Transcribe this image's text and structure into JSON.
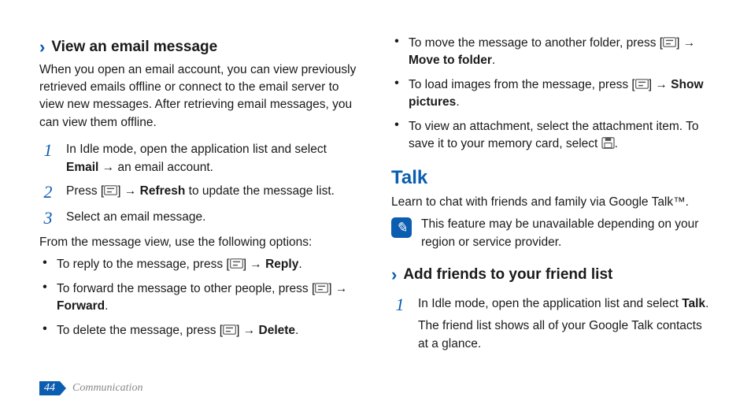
{
  "left": {
    "heading1": "View an email message",
    "intro": "When you open an email account, you can view previously retrieved emails offline or connect to the email server to view new messages. After retrieving email messages, you can view them offline.",
    "steps": {
      "s1_a": "In Idle mode, open the application list and select ",
      "s1_bold": "Email",
      "s1_b": " → an email account.",
      "s2_a": "Press [",
      "s2_b": "] → ",
      "s2_bold": "Refresh",
      "s2_c": " to update the message list.",
      "s3": "Select an email message."
    },
    "from_line": "From the message view, use the following options:",
    "bullets": {
      "b1_a": "To reply to the message, press [",
      "b1_b": "] → ",
      "b1_bold": "Reply",
      "b1_c": ".",
      "b2_a": "To forward the message to other people, press [",
      "b2_b": "] → ",
      "b2_bold": "Forward",
      "b2_c": ".",
      "b3_a": "To delete the message, press [",
      "b3_b": "] → ",
      "b3_bold": "Delete",
      "b3_c": "."
    }
  },
  "right": {
    "bullets_top": {
      "b1_a": "To move the message to another folder, press [",
      "b1_b": "] → ",
      "b1_bold": "Move to folder",
      "b1_c": ".",
      "b2_a": "To load images from the message, press [",
      "b2_b": "] → ",
      "b2_bold": "Show pictures",
      "b2_c": ".",
      "b3_a": "To view an attachment, select the attachment item. To save it to your memory card, select ",
      "b3_b": "."
    },
    "talk_heading": "Talk",
    "talk_intro": "Learn to chat with friends and family via Google Talk™.",
    "note": "This feature may be unavailable depending on your region or service provider.",
    "heading2": "Add friends to your friend list",
    "steps": {
      "s1_a": "In Idle mode, open the application list and select ",
      "s1_bold": "Talk",
      "s1_b": ".",
      "s1_line2": "The friend list shows all of your Google Talk contacts at a glance."
    }
  },
  "footer": {
    "page": "44",
    "section": "Communication"
  }
}
